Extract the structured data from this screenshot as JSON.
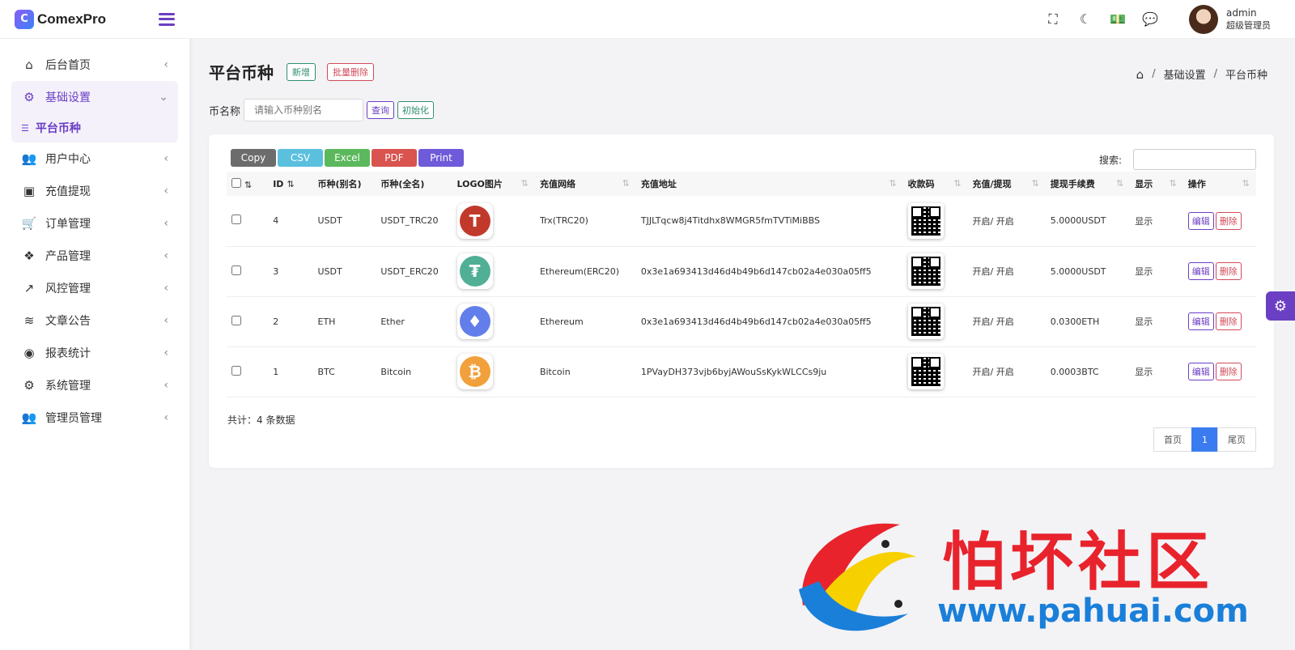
{
  "brand": {
    "name": "ComexPro",
    "logo_letter": "C"
  },
  "sidebar": {
    "items": [
      {
        "icon": "⌂",
        "label": "后台首页"
      },
      {
        "icon": "⚙",
        "label": "基础设置",
        "open": true,
        "sub": [
          {
            "label": "平台币种"
          }
        ]
      },
      {
        "icon": "👥",
        "label": "用户中心"
      },
      {
        "icon": "▣",
        "label": "充值提现"
      },
      {
        "icon": "🛒",
        "label": "订单管理"
      },
      {
        "icon": "❖",
        "label": "产品管理"
      },
      {
        "icon": "↗",
        "label": "风控管理"
      },
      {
        "icon": "≋",
        "label": "文章公告"
      },
      {
        "icon": "◉",
        "label": "报表统计"
      },
      {
        "icon": "⚙",
        "label": "系统管理"
      },
      {
        "icon": "👥",
        "label": "管理员管理"
      }
    ]
  },
  "topbar": {
    "user_name": "admin",
    "user_role": "超级管理员"
  },
  "page": {
    "title": "平台币种",
    "add_label": "新增",
    "bulk_delete_label": "批量删除",
    "breadcrumb": [
      "基础设置",
      "平台币种"
    ]
  },
  "filter": {
    "label": "币名称",
    "placeholder": "请输入币种别名",
    "search_label": "查询",
    "init_label": "初始化"
  },
  "export": [
    "Copy",
    "CSV",
    "Excel",
    "PDF",
    "Print"
  ],
  "table": {
    "search_label": "搜索:",
    "columns": [
      "ID",
      "币种(别名)",
      "币种(全名)",
      "LOGO图片",
      "充值网络",
      "充值地址",
      "收款码",
      "充值/提现",
      "提现手续费",
      "显示",
      "操作"
    ],
    "rows": [
      {
        "id": "4",
        "alias": "USDT",
        "full": "USDT_TRC20",
        "logo": "T",
        "logo_color": "#c0392b",
        "network": "Trx(TRC20)",
        "address": "TJJLTqcw8j4Titdhx8WMGR5fmTVTiMiBBS",
        "toggle": "开启/ 开启",
        "fee": "5.0000USDT",
        "show": "显示"
      },
      {
        "id": "3",
        "alias": "USDT",
        "full": "USDT_ERC20",
        "logo": "₮",
        "logo_color": "#50af95",
        "network": "Ethereum(ERC20)",
        "address": "0x3e1a693413d46d4b49b6d147cb02a4e030a05ff5",
        "toggle": "开启/ 开启",
        "fee": "5.0000USDT",
        "show": "显示"
      },
      {
        "id": "2",
        "alias": "ETH",
        "full": "Ether",
        "logo": "♦",
        "logo_color": "#627eea",
        "network": "Ethereum",
        "address": "0x3e1a693413d46d4b49b6d147cb02a4e030a05ff5",
        "toggle": "开启/ 开启",
        "fee": "0.0300ETH",
        "show": "显示"
      },
      {
        "id": "1",
        "alias": "BTC",
        "full": "Bitcoin",
        "logo": "₿",
        "logo_color": "#f2a03c",
        "network": "Bitcoin",
        "address": "1PVayDH373vjb6byjAWouSsKykWLCCs9ju",
        "toggle": "开启/ 开启",
        "fee": "0.0003BTC",
        "show": "显示"
      }
    ],
    "edit_label": "编辑",
    "delete_label": "删除",
    "total": "共计：4 条数据"
  },
  "pagination": {
    "first": "首页",
    "current": "1",
    "last": "尾页"
  },
  "watermark": {
    "title": "怕坏社区",
    "url": "www.pahuai.com"
  }
}
